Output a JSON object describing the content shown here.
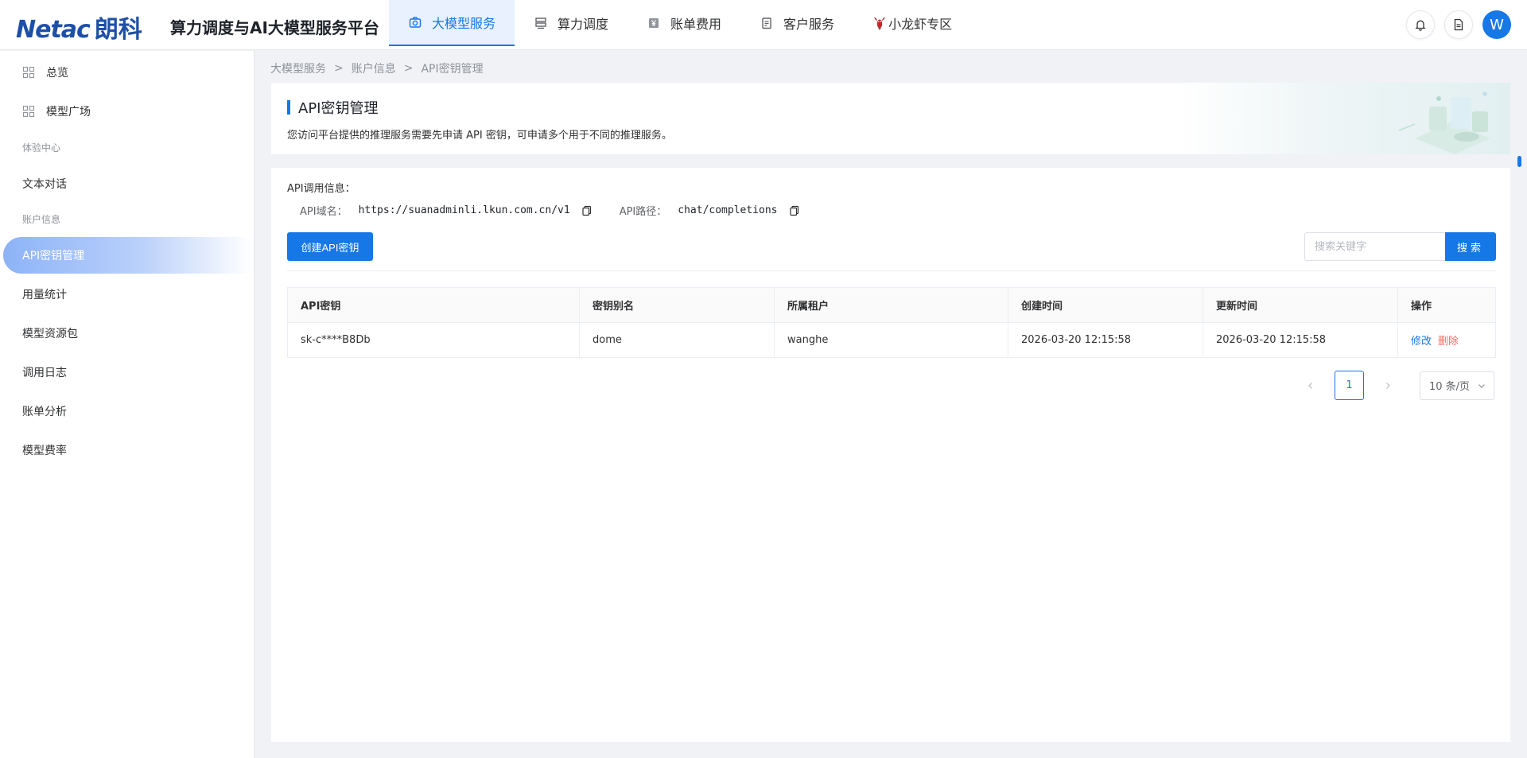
{
  "header": {
    "logo_en": "Netac",
    "logo_cn": "朗科",
    "platform_title": "算力调度与AI大模型服务平台",
    "nav": [
      {
        "label": "大模型服务",
        "icon": "camera-icon",
        "active": true
      },
      {
        "label": "算力调度",
        "icon": "server-icon",
        "active": false
      },
      {
        "label": "账单费用",
        "icon": "yen-icon",
        "active": false
      },
      {
        "label": "客户服务",
        "icon": "clipboard-icon",
        "active": false
      },
      {
        "label": "小龙虾专区",
        "icon": "lobster-icon",
        "active": false
      }
    ],
    "avatar_letter": "W"
  },
  "sidebar": {
    "items": [
      {
        "label": "总览"
      },
      {
        "label": "模型广场"
      },
      {
        "label": "文本对话"
      },
      {
        "label": "API密钥管理"
      },
      {
        "label": "用量统计"
      },
      {
        "label": "模型资源包"
      },
      {
        "label": "调用日志"
      },
      {
        "label": "账单分析"
      },
      {
        "label": "模型费率"
      }
    ],
    "groups": {
      "experience": "体验中心",
      "account": "账户信息"
    }
  },
  "breadcrumb": [
    "大模型服务",
    "账户信息",
    "API密钥管理"
  ],
  "banner": {
    "title": "API密钥管理",
    "description": "您访问平台提供的推理服务需要先申请 API 密钥，可申请多个用于不同的推理服务。"
  },
  "api_info": {
    "title": "API调用信息：",
    "domain_label": "API域名：",
    "domain_value": "https://suanadminli.lkun.com.cn/v1",
    "path_label": "API路径：",
    "path_value": "chat/completions"
  },
  "toolbar": {
    "create_label": "创建API密钥",
    "search_placeholder": "搜索关键字",
    "search_label": "搜索"
  },
  "table": {
    "columns": [
      "API密钥",
      "密钥别名",
      "所属租户",
      "创建时间",
      "更新时间",
      "操作"
    ],
    "rows": [
      {
        "key": "sk-c****B8Db",
        "alias": "dome",
        "tenant": "wanghe",
        "created": "2026-03-20 12:15:58",
        "updated": "2026-03-20 12:15:58",
        "edit": "修改",
        "delete": "删除"
      }
    ]
  },
  "pagination": {
    "current_page": "1",
    "page_size": "10 条/页"
  },
  "colors": {
    "primary": "#1677e6",
    "danger": "#f56c6c",
    "brand": "#1e4fa8"
  }
}
